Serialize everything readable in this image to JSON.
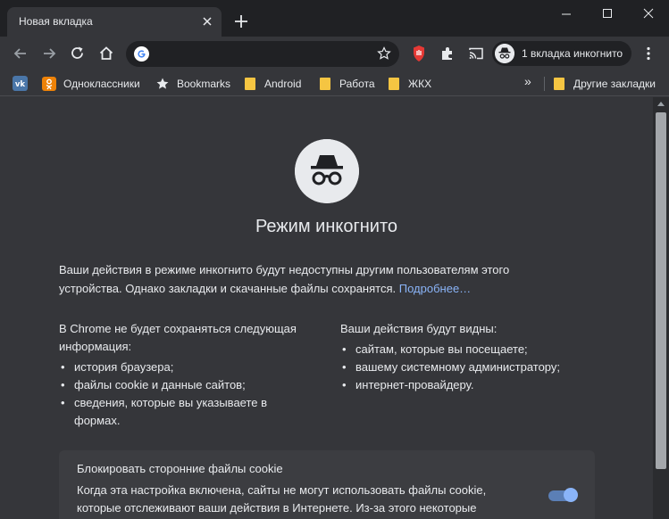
{
  "tab": {
    "title": "Новая вкладка"
  },
  "toolbar": {
    "omnibox_value": "",
    "incognito_label": "1 вкладка инкогнито"
  },
  "bookmarks": {
    "items": [
      {
        "label": "Одноклассники",
        "icon": "odnoklassniki-icon"
      },
      {
        "label": "Bookmarks",
        "icon": "star-icon"
      },
      {
        "label": "Android",
        "icon": "folder-icon"
      },
      {
        "label": "Работа",
        "icon": "folder-icon"
      },
      {
        "label": "ЖКХ",
        "icon": "folder-icon"
      }
    ],
    "overflow": "»",
    "other": "Другие закладки"
  },
  "page": {
    "title": "Режим инкогнито",
    "intro": "Ваши действия в режиме инкогнито будут недоступны другим пользователям этого устройства. Однако закладки и скачанные файлы сохранятся.",
    "learn_more": "Подробнее…",
    "left_heading": "В Chrome не будет сохраняться следующая информация:",
    "left_items": [
      "история браузера;",
      "файлы cookie и данные сайтов;",
      "сведения, которые вы указываете в формах."
    ],
    "right_heading": "Ваши действия будут видны:",
    "right_items": [
      "сайтам, которые вы посещаете;",
      "вашему системному администратору;",
      "интернет-провайдеру."
    ],
    "cookie_title": "Блокировать сторонние файлы cookie",
    "cookie_text": "Когда эта настройка включена, сайты не могут использовать файлы cookie, которые отслеживают ваши действия в Интернете. Из-за этого некоторые",
    "cookie_toggle_on": true
  },
  "colors": {
    "accent": "#8ab4f8",
    "background": "#35363a",
    "frame": "#202124"
  }
}
